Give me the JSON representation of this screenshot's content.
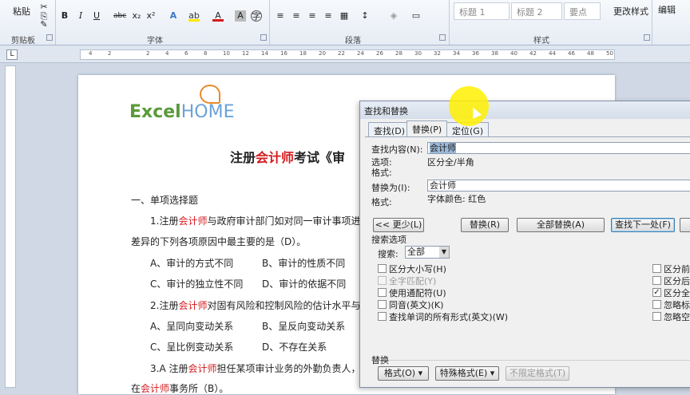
{
  "ribbon": {
    "paste_label": "粘贴",
    "clipboard_label": "剪贴板",
    "font_label": "字体",
    "paragraph_label": "段落",
    "styles_label": "样式",
    "heading1": "标题 1",
    "heading2": "标题 2",
    "emphasis": "要点",
    "change_styles": "更改样式",
    "edit_label": "编辑"
  },
  "ruler": {
    "ticks": [
      "4",
      "2",
      "",
      "2",
      "4",
      "6",
      "8",
      "10",
      "12",
      "14",
      "16",
      "18",
      "20",
      "22",
      "24",
      "26",
      "28",
      "30",
      "32",
      "34",
      "36",
      "38",
      "40",
      "42",
      "44",
      "46",
      "48",
      "50"
    ]
  },
  "document": {
    "logo_excel": "Excel",
    "logo_home": "HOME",
    "title_pre": "注册",
    "title_red": "会计师",
    "title_post": "考试《审",
    "section1": "一、单项选择题",
    "q1_pre": "1.注册",
    "q1_red": "会计师",
    "q1_post": "与政府审计部门如对同一审计事项进行",
    "q1_line2": "差异的下列各项原因中最主要的是（D）。",
    "q1_a": "A、审计的方式不同",
    "q1_b": "B、审计的性质不同",
    "q1_c": "C、审计的独立性不同",
    "q1_d": "D、审计的依据不同",
    "q2_pre": "2.注册",
    "q2_red": "会计师",
    "q2_post": "对固有风险和控制风险的估计水平与",
    "q2_a": "A、呈同向变动关系",
    "q2_b": "B、呈反向变动关系",
    "q2_c": "C、呈比例变动关系",
    "q2_d": "D、不存在关系",
    "q3_pre": "3.A 注册",
    "q3_red": "会计师",
    "q3_post": "担任某项审计业务的外勤负责人，如",
    "q3_line2_pre": "在",
    "q3_line2_red": "会计师",
    "q3_line2_post": "事务所（B）。"
  },
  "dialog": {
    "title": "查找和替换",
    "tabs": [
      "查找(D)",
      "替换(P)",
      "定位(G)"
    ],
    "find_label": "查找内容(N):",
    "find_value": "会计师",
    "options_label": "选项:",
    "options_value": "区分全/半角",
    "format_label": "格式:",
    "replace_label": "替换为(I):",
    "replace_value": "会计师",
    "replace_format_label": "格式:",
    "replace_format_value": "字体颜色: 红色",
    "less_button": "<< 更少(L)",
    "replace_button": "替换(R)",
    "replace_all_button": "全部替换(A)",
    "find_next_button": "查找下一处(F)",
    "search_options_title": "搜索选项",
    "search_label": "搜索:",
    "search_value": "全部",
    "checks_left": [
      {
        "label": "区分大小写(H)",
        "checked": false,
        "disabled": false
      },
      {
        "label": "全字匹配(Y)",
        "checked": false,
        "disabled": true
      },
      {
        "label": "使用通配符(U)",
        "checked": false,
        "disabled": false
      },
      {
        "label": "同音(英文)(K)",
        "checked": false,
        "disabled": false
      },
      {
        "label": "查找单词的所有形式(英文)(W)",
        "checked": false,
        "disabled": false
      }
    ],
    "checks_right": [
      {
        "label": "区分前缀",
        "checked": false
      },
      {
        "label": "区分后缀",
        "checked": false
      },
      {
        "label": "区分全/",
        "checked": true
      },
      {
        "label": "忽略标点",
        "checked": false
      },
      {
        "label": "忽略空格",
        "checked": false
      }
    ],
    "replace_section": "替换",
    "format_button": "格式(O) ▾",
    "special_button": "特殊格式(E) ▾",
    "no_format_button": "不限定格式(T)"
  }
}
